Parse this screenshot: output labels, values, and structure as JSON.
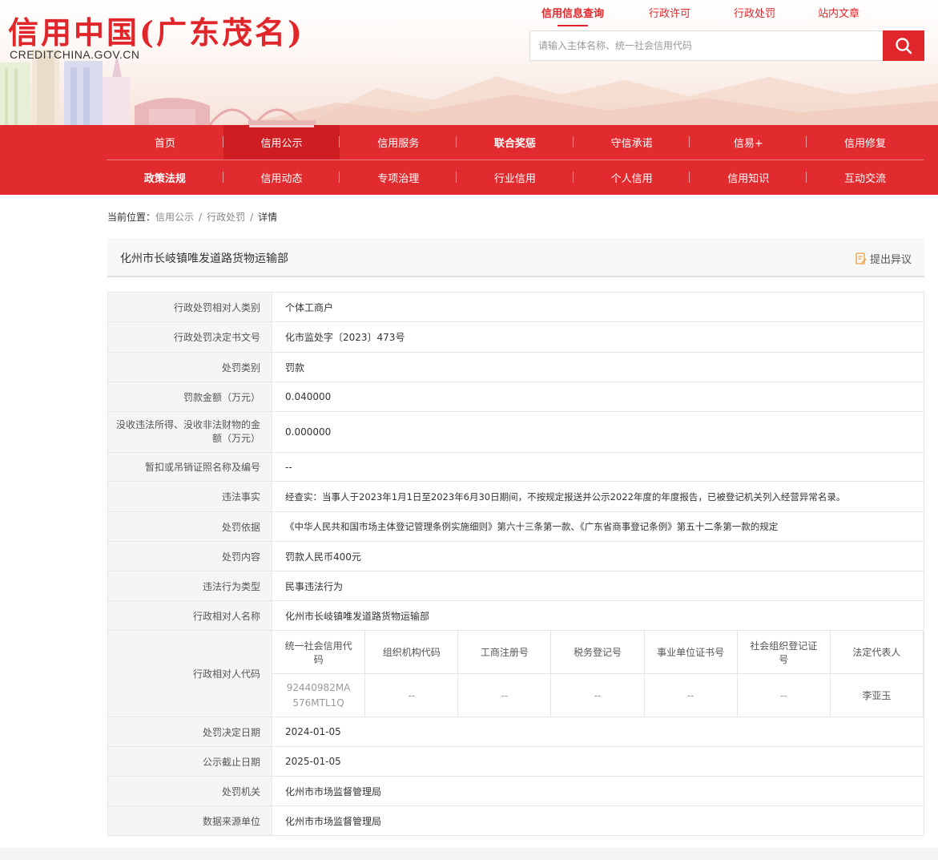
{
  "header": {
    "logo_cn": "信用中国(广东茂名)",
    "logo_en": "CREDITCHINA.GOV.CN",
    "search_tabs": [
      "信用信息查询",
      "行政许可",
      "行政处罚",
      "站内文章"
    ],
    "search_placeholder": "请输入主体名称、统一社会信用代码",
    "search_icon": "search-icon"
  },
  "nav": {
    "row1": [
      "首页",
      "信用公示",
      "信用服务",
      "联合奖惩",
      "守信承诺",
      "信易+",
      "信用修复"
    ],
    "row2": [
      "政策法规",
      "信用动态",
      "专项治理",
      "行业信用",
      "个人信用",
      "信用知识",
      "互动交流"
    ]
  },
  "breadcrumb": {
    "prefix": "当前位置：",
    "items": [
      "信用公示",
      "行政处罚",
      "详情"
    ],
    "separator": "/"
  },
  "title": "化州市长岐镇唯发道路货物运输部",
  "objection_label": "提出异议",
  "rows": [
    {
      "label": "行政处罚相对人类别",
      "value": "个体工商户"
    },
    {
      "label": "行政处罚决定书文号",
      "value": "化市监处字〔2023〕473号"
    },
    {
      "label": "处罚类别",
      "value": "罚款"
    },
    {
      "label": "罚款金额（万元）",
      "value": "0.040000"
    },
    {
      "label": "没收违法所得、没收非法财物的金额（万元）",
      "value": "0.000000"
    },
    {
      "label": "暂扣或吊销证照名称及编号",
      "value": "--"
    },
    {
      "label": "违法事实",
      "value": "经查实：当事人于2023年1月1日至2023年6月30日期间，不按规定报送并公示2022年度的年度报告，已被登记机关列入经营异常名录。"
    },
    {
      "label": "处罚依据",
      "value": "《中华人民共和国市场主体登记管理条例实施细则》第六十三条第一款、《广东省商事登记条例》第五十二条第一款的规定"
    },
    {
      "label": "处罚内容",
      "value": "罚款人民币400元"
    },
    {
      "label": "违法行为类型",
      "value": "民事违法行为"
    },
    {
      "label": "行政相对人名称",
      "value": "化州市长岐镇唯发道路货物运输部"
    }
  ],
  "codes": {
    "label": "行政相对人代码",
    "headers": [
      "统一社会信用代码",
      "组织机构代码",
      "工商注册号",
      "税务登记号",
      "事业单位证书号",
      "社会组织登记证号",
      "法定代表人"
    ],
    "values": [
      "92440982MA576MTL1Q",
      "--",
      "--",
      "--",
      "--",
      "--",
      "李亚玉"
    ]
  },
  "rows2": [
    {
      "label": "处罚决定日期",
      "value": "2024-01-05"
    },
    {
      "label": "公示截止日期",
      "value": "2025-01-05"
    },
    {
      "label": "处罚机关",
      "value": "化州市市场监督管理局"
    },
    {
      "label": "数据来源单位",
      "value": "化州市市场监督管理局"
    }
  ],
  "colors": {
    "brand_red": "#e1262b",
    "nav_red": "#e22b2f"
  }
}
